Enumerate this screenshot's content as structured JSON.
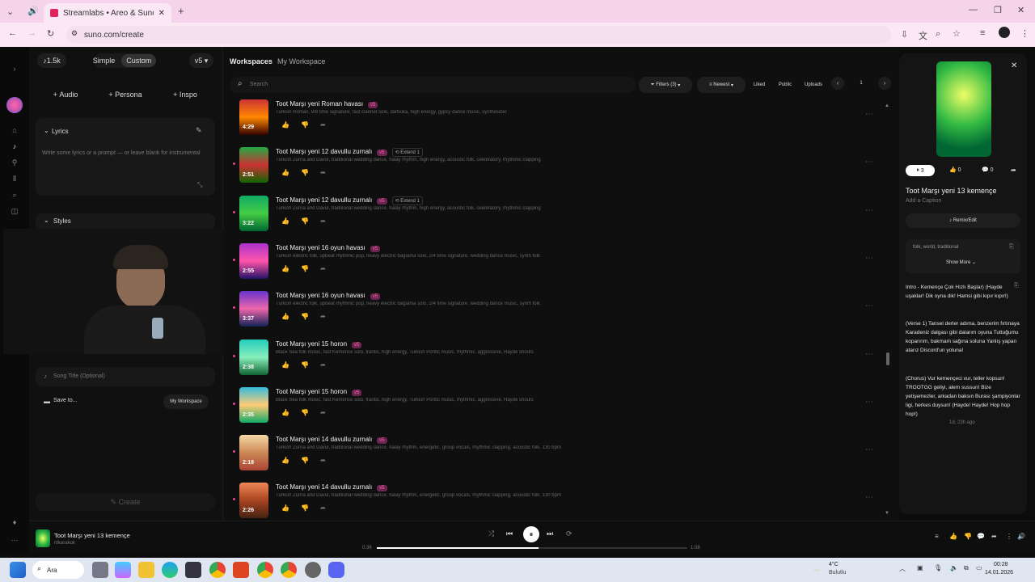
{
  "browser": {
    "tab_title": "Streamlabs • Areo & Suno",
    "url": "suno.com/create"
  },
  "creator": {
    "credits": "1.5k",
    "mode_simple": "Simple",
    "mode_custom": "Custom",
    "version": "v5",
    "btn_audio": "Audio",
    "btn_persona": "Persona",
    "btn_inspo": "Inspo",
    "lyrics_label": "Lyrics",
    "lyrics_placeholder": "Write some lyrics or a prompt — or leave blank for instrumental",
    "styles_label": "Styles",
    "song_title_placeholder": "Song Title (Optional)",
    "save_to_label": "Save to...",
    "workspace_btn": "My Workspace",
    "create_btn": "Create"
  },
  "main": {
    "breadcrumb_root": "Workspaces",
    "breadcrumb_current": "My Workspace",
    "search_placeholder": "Search",
    "filters": "Filters (3)",
    "sort": "Newest",
    "liked": "Liked",
    "public": "Public",
    "uploads": "Uploads",
    "page": "1",
    "songs": [
      {
        "title": "Toot Marşı yeni Roman havası",
        "desc": "Turkish Roman, 9/8 time signature, fast clarinet solo, darbuka, high energy, gypsy dance music, synthesizer",
        "duration": "4:29",
        "badge": "v5",
        "extend": "",
        "grad": "linear-gradient(#c33,#f80,#300)"
      },
      {
        "title": "Toot Marşı yeni 12 davullu zurnalı",
        "desc": "Turkish Zurna and Davul, traditional wedding dance, halay rhythm, high energy, acoustic folk, celebratory, rhythmic clapping",
        "duration": "2:51",
        "badge": "v5",
        "extend": "Extend 1",
        "grad": "linear-gradient(#2a4,#c33,#160)"
      },
      {
        "title": "Toot Marşı yeni 12 davullu zurnalı",
        "desc": "Turkish Zurna and Davul, traditional wedding dance, halay rhythm, high energy, acoustic folk, celebratory, rhythmic clapping",
        "duration": "3:22",
        "badge": "v5",
        "extend": "Extend 1",
        "grad": "linear-gradient(#1a6,#4c4,#063)"
      },
      {
        "title": "Toot Marşı yeni 16 oyun havası",
        "desc": "Turkish electric folk, upbeat rhythmic pop, heavy electric baglama solo, 2/4 time signature, wedding dance music, synth folk",
        "duration": "2:55",
        "badge": "v5",
        "extend": "",
        "grad": "linear-gradient(#a3c,#f5a,#216)"
      },
      {
        "title": "Toot Marşı yeni 16 oyun havası",
        "desc": "Turkish electric folk, upbeat rhythmic pop, heavy electric baglama solo, 2/4 time signature, wedding dance music, synth folk",
        "duration": "3:37",
        "badge": "v5",
        "extend": "",
        "grad": "linear-gradient(#63c,#e6a,#125)"
      },
      {
        "title": "Toot Marşı yeni 15 horon",
        "desc": "Black Sea folk music, fast Kemence solo, frantic, high energy, Turkish Pontic music, rhythmic, aggressive, Hayde shouts",
        "duration": "2:38",
        "badge": "v5",
        "extend": "",
        "grad": "linear-gradient(#2cb,#8eb,#163)"
      },
      {
        "title": "Toot Marşı yeni 15 horon",
        "desc": "Black Sea folk music, fast Kemence solo, frantic, high energy, Turkish Pontic music, rhythmic, aggressive, Hayde shouts",
        "duration": "2:35",
        "badge": "v5",
        "extend": "",
        "grad": "linear-gradient(#3bd,#fc7,#1a6)"
      },
      {
        "title": "Toot Marşı yeni 14 davullu zurnalı",
        "desc": "Turkish Zurna and Davul, traditional wedding dance, halay rhythm, energetic, group vocals, rhythmic clapping, acoustic folk, 130 bpm",
        "duration": "2:18",
        "badge": "v5",
        "extend": "",
        "grad": "linear-gradient(#f4d9a6,#c85,#a43)"
      },
      {
        "title": "Toot Marşı yeni 14 davullu zurnalı",
        "desc": "Turkish Zurna and Davul, traditional wedding dance, halay rhythm, energetic, group vocals, rhythmic clapping, acoustic folk, 130 bpm",
        "duration": "2:26",
        "badge": "v5",
        "extend": "",
        "grad": "linear-gradient(#e85,#a42,#421)"
      }
    ]
  },
  "detail": {
    "plays": "3",
    "likes": "0",
    "comments": "0",
    "title": "Toot Marşı yeni 13 kemençe",
    "caption": "Add a Caption",
    "remix": "Remix/Edit",
    "tags": "folk, world, traditional",
    "show_more": "Show More",
    "lyrics_1": "Intro - Kemençe Çok Hızlı Başlar) (Hayde uşaklar! Dik oyna dik! Hamsi gibi kıpır kıpır!)",
    "lyrics_2": "(Verse 1) Tansel derler adıma, benzerim fırtınaya Karadeniz dalgası gibi dalarım oyuna Tuttuğumu koparırım, bakmam sağına soluna Yanlış yaparı atarız Discord'un yoluna!",
    "lyrics_3": "(Chorus) Vur kemençeci vur, teller kopsun! TROOTGG geliyi, alem sussun! Bize yetişemezler, arkadan baksın Burası şampiyonlar ligi, herkes duysun! (Hayde! Hayde! Hop hop hop!)",
    "time_ago": "1d, 23h ago"
  },
  "player": {
    "title": "Toot Marşı yeni 13 kemençe",
    "artist": "ntkarakok",
    "elapsed": "0:36",
    "total": "1:08",
    "progress": 0.52
  },
  "taskbar": {
    "search": "Ara",
    "weather_temp": "4°C",
    "weather_desc": "Bulutlu",
    "time": "00:28",
    "date": "14.01.2026"
  }
}
